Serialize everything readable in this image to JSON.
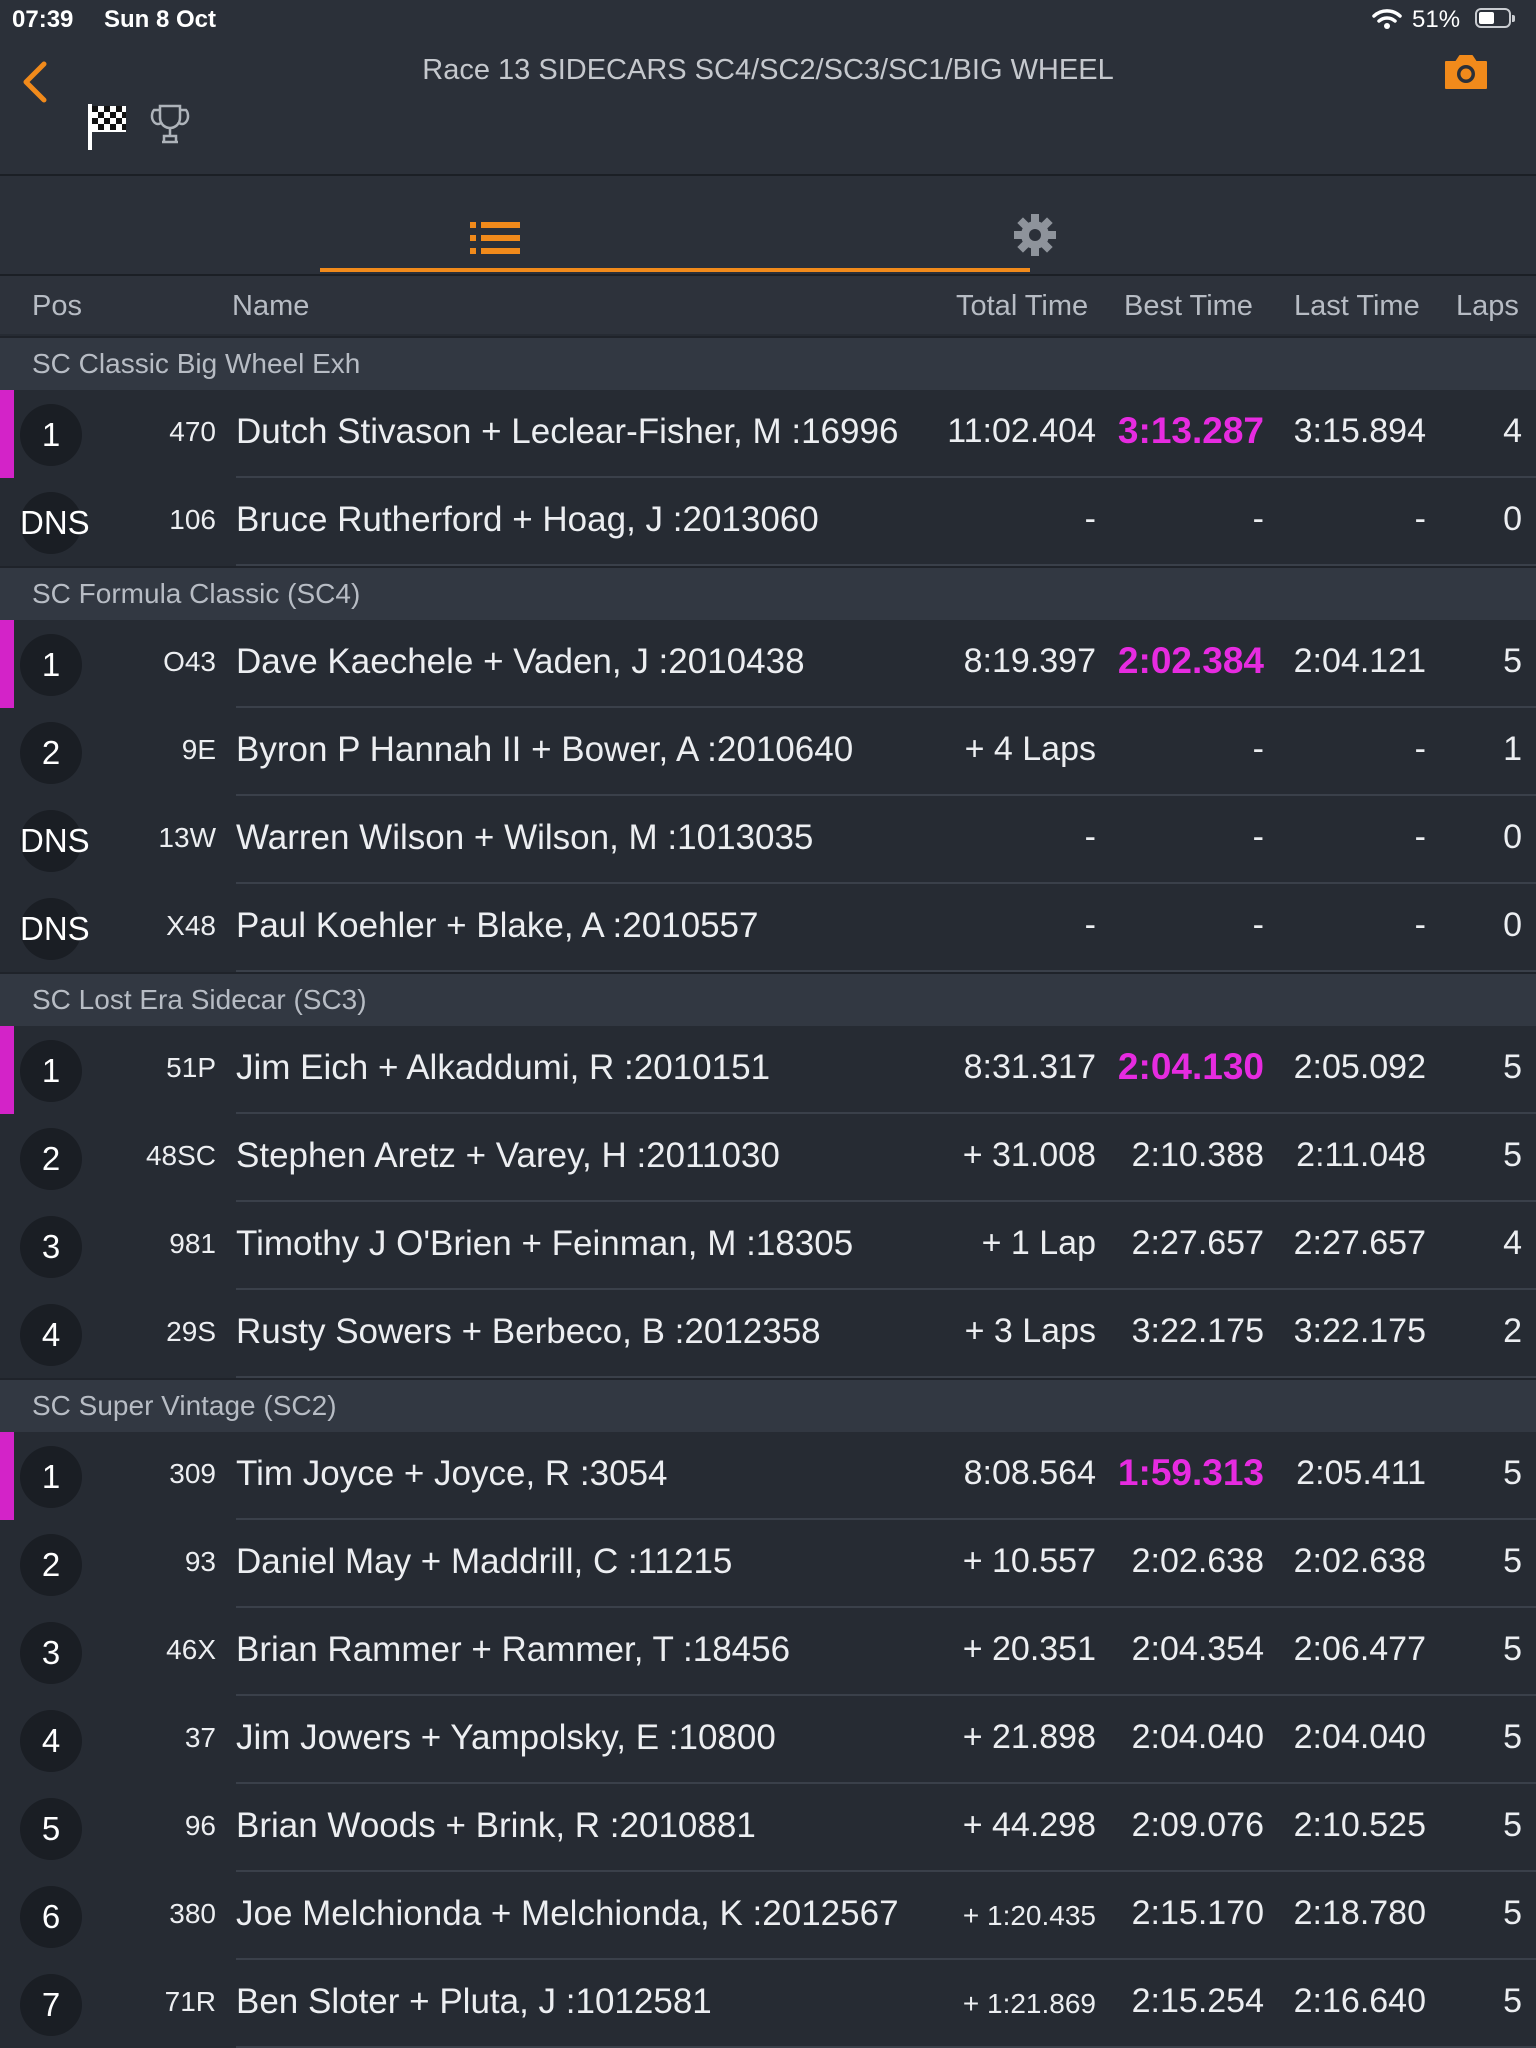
{
  "status": {
    "time": "07:39",
    "date": "Sun 8 Oct",
    "battery": "51%"
  },
  "header": {
    "title": "Race 13 SIDECARS SC4/SC2/SC3/SC1/BIG WHEEL"
  },
  "columns": {
    "pos": "Pos",
    "name": "Name",
    "total": "Total Time",
    "best": "Best Time",
    "last": "Last Time",
    "laps": "Laps"
  },
  "colors": {
    "accent": "#f18a1b",
    "best_highlight": "#e62be0",
    "leader_bar": "#d323c8"
  },
  "groups": [
    {
      "label": "SC Classic Big Wheel Exh",
      "rows": [
        {
          "pos": "1",
          "num": "470",
          "name": "Dutch Stivason + Leclear-Fisher, M :16996",
          "total": "11:02.404",
          "best": "3:13.287",
          "last": "3:15.894",
          "laps": "4"
        },
        {
          "pos": "DNS",
          "num": "106",
          "name": "Bruce Rutherford + Hoag, J :2013060",
          "total": "-",
          "best": "-",
          "last": "-",
          "laps": "0"
        }
      ]
    },
    {
      "label": "SC Formula Classic (SC4)",
      "rows": [
        {
          "pos": "1",
          "num": "O43",
          "name": "Dave Kaechele + Vaden, J :2010438",
          "total": "8:19.397",
          "best": "2:02.384",
          "last": "2:04.121",
          "laps": "5"
        },
        {
          "pos": "2",
          "num": "9E",
          "name": "Byron P Hannah II + Bower, A :2010640",
          "total": "+ 4 Laps",
          "best": "-",
          "last": "-",
          "laps": "1"
        },
        {
          "pos": "DNS",
          "num": "13W",
          "name": "Warren Wilson + Wilson, M :1013035",
          "total": "-",
          "best": "-",
          "last": "-",
          "laps": "0"
        },
        {
          "pos": "DNS",
          "num": "X48",
          "name": "Paul Koehler + Blake, A :2010557",
          "total": "-",
          "best": "-",
          "last": "-",
          "laps": "0"
        }
      ]
    },
    {
      "label": "SC Lost Era Sidecar (SC3)",
      "rows": [
        {
          "pos": "1",
          "num": "51P",
          "name": "Jim Eich + Alkaddumi, R :2010151",
          "total": "8:31.317",
          "best": "2:04.130",
          "last": "2:05.092",
          "laps": "5"
        },
        {
          "pos": "2",
          "num": "48SC",
          "name": "Stephen Aretz + Varey, H :2011030",
          "total": "+ 31.008",
          "best": "2:10.388",
          "last": "2:11.048",
          "laps": "5"
        },
        {
          "pos": "3",
          "num": "981",
          "name": "Timothy J O'Brien + Feinman, M :18305",
          "total": "+ 1 Lap",
          "best": "2:27.657",
          "last": "2:27.657",
          "laps": "4"
        },
        {
          "pos": "4",
          "num": "29S",
          "name": "Rusty Sowers + Berbeco, B :2012358",
          "total": "+ 3 Laps",
          "best": "3:22.175",
          "last": "3:22.175",
          "laps": "2"
        }
      ]
    },
    {
      "label": "SC Super Vintage (SC2)",
      "rows": [
        {
          "pos": "1",
          "num": "309",
          "name": "Tim Joyce + Joyce, R :3054",
          "total": "8:08.564",
          "best": "1:59.313",
          "last": "2:05.411",
          "laps": "5"
        },
        {
          "pos": "2",
          "num": "93",
          "name": "Daniel May + Maddrill, C :11215",
          "total": "+ 10.557",
          "best": "2:02.638",
          "last": "2:02.638",
          "laps": "5"
        },
        {
          "pos": "3",
          "num": "46X",
          "name": "Brian Rammer + Rammer, T :18456",
          "total": "+ 20.351",
          "best": "2:04.354",
          "last": "2:06.477",
          "laps": "5"
        },
        {
          "pos": "4",
          "num": "37",
          "name": "Jim Jowers + Yampolsky, E :10800",
          "total": "+ 21.898",
          "best": "2:04.040",
          "last": "2:04.040",
          "laps": "5"
        },
        {
          "pos": "5",
          "num": "96",
          "name": "Brian Woods + Brink, R :2010881",
          "total": "+ 44.298",
          "best": "2:09.076",
          "last": "2:10.525",
          "laps": "5"
        },
        {
          "pos": "6",
          "num": "380",
          "name": "Joe Melchionda + Melchionda, K :2012567",
          "total": "+ 1:20.435",
          "best": "2:15.170",
          "last": "2:18.780",
          "laps": "5"
        },
        {
          "pos": "7",
          "num": "71R",
          "name": "Ben Sloter + Pluta, J :1012581",
          "total": "+ 1:21.869",
          "best": "2:15.254",
          "last": "2:16.640",
          "laps": "5"
        }
      ]
    }
  ]
}
